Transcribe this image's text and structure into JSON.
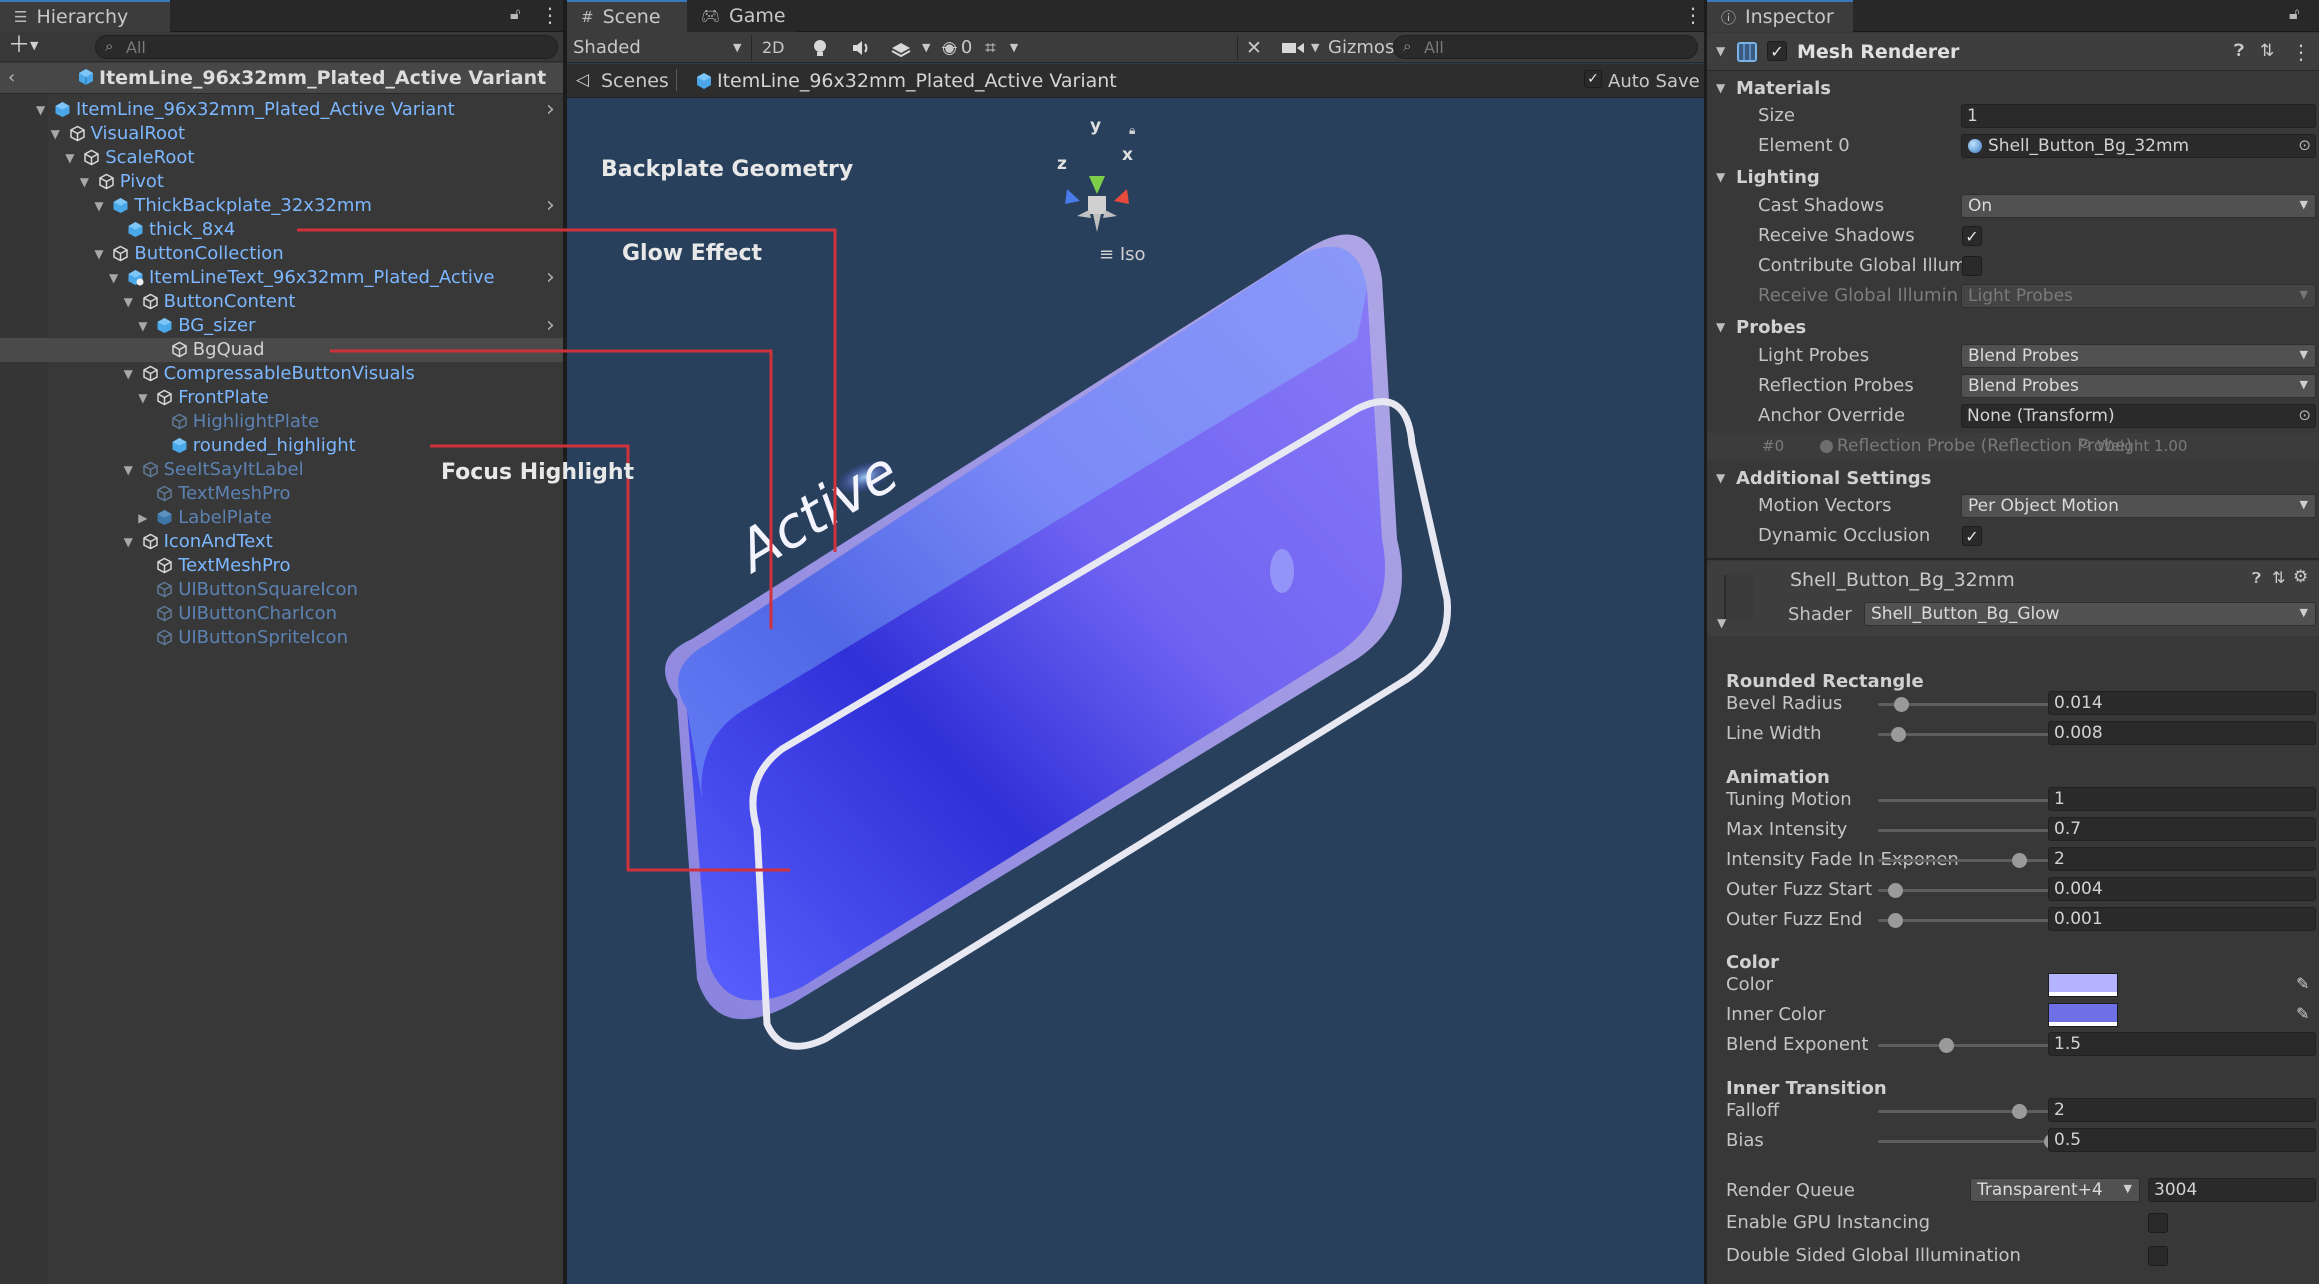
{
  "hierarchy": {
    "tab_label": "Hierarchy",
    "search_placeholder": "All",
    "prefab_title": "ItemLine_96x32mm_Plated_Active Variant",
    "rows": [
      {
        "label": "ItemLine_96x32mm_Plated_Active Variant",
        "icon": "prefab-cube-icon",
        "style": "blue"
      },
      {
        "label": "VisualRoot",
        "icon": "gameobject-cube-icon",
        "style": "blue"
      },
      {
        "label": "ScaleRoot",
        "icon": "gameobject-cube-icon",
        "style": "blue"
      },
      {
        "label": "Pivot",
        "icon": "gameobject-cube-icon",
        "style": "blue"
      },
      {
        "label": "ThickBackplate_32x32mm",
        "icon": "prefab-cube-icon",
        "style": "blue"
      },
      {
        "label": "thick_8x4",
        "icon": "prefab-cube-icon",
        "style": "blue"
      },
      {
        "label": "ButtonCollection",
        "icon": "gameobject-cube-icon",
        "style": "blue"
      },
      {
        "label": "ItemLineText_96x32mm_Plated_Active",
        "icon": "prefab-variant-icon",
        "style": "blue"
      },
      {
        "label": "ButtonContent",
        "icon": "gameobject-cube-icon",
        "style": "blue"
      },
      {
        "label": "BG_sizer",
        "icon": "prefab-cube-icon",
        "style": "blue"
      },
      {
        "label": "BgQuad",
        "icon": "gameobject-cube-icon",
        "style": "white"
      },
      {
        "label": "CompressableButtonVisuals",
        "icon": "gameobject-cube-icon",
        "style": "blue"
      },
      {
        "label": "FrontPlate",
        "icon": "gameobject-cube-icon",
        "style": "blue"
      },
      {
        "label": "HighlightPlate",
        "icon": "gameobject-cube-icon",
        "style": "dim"
      },
      {
        "label": "rounded_highlight",
        "icon": "prefab-cube-icon",
        "style": "blue"
      },
      {
        "label": "SeeItSayItLabel",
        "icon": "gameobject-cube-icon",
        "style": "dim"
      },
      {
        "label": "TextMeshPro",
        "icon": "gameobject-cube-icon",
        "style": "dim"
      },
      {
        "label": "LabelPlate",
        "icon": "prefab-cube-icon",
        "style": "dim"
      },
      {
        "label": "IconAndText",
        "icon": "gameobject-cube-icon",
        "style": "blue"
      },
      {
        "label": "TextMeshPro",
        "icon": "gameobject-cube-icon",
        "style": "blue"
      },
      {
        "label": "UIButtonSquareIcon",
        "icon": "gameobject-cube-icon",
        "style": "dim"
      },
      {
        "label": "UIButtonCharIcon",
        "icon": "gameobject-cube-icon",
        "style": "dim"
      },
      {
        "label": "UIButtonSpriteIcon",
        "icon": "gameobject-cube-icon",
        "style": "dim"
      }
    ]
  },
  "scene": {
    "tabs": [
      {
        "label": "Scene",
        "icon": "grid-icon"
      },
      {
        "label": "Game",
        "icon": "gamepad-icon"
      }
    ],
    "toolbar": {
      "draw_mode": "Shaded",
      "two_d": "2D",
      "hidden_count": "0",
      "gizmos": "Gizmos",
      "search_placeholder": "All"
    },
    "breadcrumb": {
      "root": "Scenes",
      "current": "ItemLine_96x32mm_Plated_Active Variant",
      "auto_save": "Auto Save"
    },
    "gizmo": {
      "y": "y",
      "x": "x",
      "z": "z",
      "view": "Iso"
    },
    "button_text": "Active",
    "annotations": {
      "backplate": "Backplate Geometry",
      "glow": "Glow Effect",
      "focus": "Focus Highlight"
    },
    "annotation_color": "#d0323c"
  },
  "inspector": {
    "tab_label": "Inspector",
    "component_title": "Mesh Renderer",
    "materials_header": "Materials",
    "size_label": "Size",
    "size_value": "1",
    "element0_label": "Element 0",
    "element0_value": "Shell_Button_Bg_32mm",
    "lighting_header": "Lighting",
    "cast_shadows_label": "Cast Shadows",
    "cast_shadows_value": "On",
    "receive_shadows_label": "Receive Shadows",
    "contribute_gi_label": "Contribute Global Illum",
    "receive_gi_label": "Receive Global Illumina",
    "receive_gi_value": "Light Probes",
    "probes_header": "Probes",
    "light_probes_label": "Light Probes",
    "light_probes_value": "Blend Probes",
    "reflection_probes_label": "Reflection Probes",
    "reflection_probes_value": "Blend Probes",
    "anchor_override_label": "Anchor Override",
    "anchor_override_value": "None (Transform)",
    "probe_index": "#0",
    "probe_entry": "Reflection Probe (Reflection Probe)",
    "probe_weight": "Weight 1.00",
    "additional_header": "Additional Settings",
    "motion_vectors_label": "Motion Vectors",
    "motion_vectors_value": "Per Object Motion",
    "dynamic_occlusion_label": "Dynamic Occlusion",
    "material_name": "Shell_Button_Bg_32mm",
    "shader_label": "Shader",
    "shader_value": "Shell_Button_Bg_Glow",
    "rounded_rect_header": "Rounded Rectangle",
    "bevel_radius_label": "Bevel Radius",
    "bevel_radius_value": "0.014",
    "bevel_radius_pos": 0.05,
    "line_width_label": "Line Width",
    "line_width_value": "0.008",
    "line_width_pos": 0.04,
    "animation_header": "Animation",
    "tuning_motion_label": "Tuning Motion",
    "tuning_motion_value": "1",
    "tuning_motion_pos": 1.0,
    "max_intensity_label": "Max Intensity",
    "max_intensity_value": "0.7",
    "max_intensity_pos": 0.71,
    "fade_label": "Intensity Fade In Exponen",
    "fade_value": "2",
    "fade_pos": 0.42,
    "outer_fuzz_start_label": "Outer Fuzz Start",
    "outer_fuzz_start_value": "0.004",
    "outer_fuzz_start_pos": 0.03,
    "outer_fuzz_end_label": "Outer Fuzz End",
    "outer_fuzz_end_value": "0.001",
    "outer_fuzz_end_pos": 0.03,
    "color_header": "Color",
    "color_label": "Color",
    "color_value": "#b3b3ff",
    "inner_color_label": "Inner Color",
    "inner_color_value": "#6f6fe6",
    "blend_exponent_label": "Blend Exponent",
    "blend_exponent_value": "1.5",
    "blend_exponent_pos": 0.19,
    "inner_transition_header": "Inner Transition",
    "falloff_label": "Falloff",
    "falloff_value": "2",
    "falloff_pos": 0.42,
    "bias_label": "Bias",
    "bias_value": "0.5",
    "bias_pos": 0.52,
    "render_queue_label": "Render Queue",
    "render_queue_mode": "Transparent+4",
    "render_queue_value": "3004",
    "gpu_instancing_label": "Enable GPU Instancing",
    "double_sided_gi_label": "Double Sided Global Illumination"
  }
}
